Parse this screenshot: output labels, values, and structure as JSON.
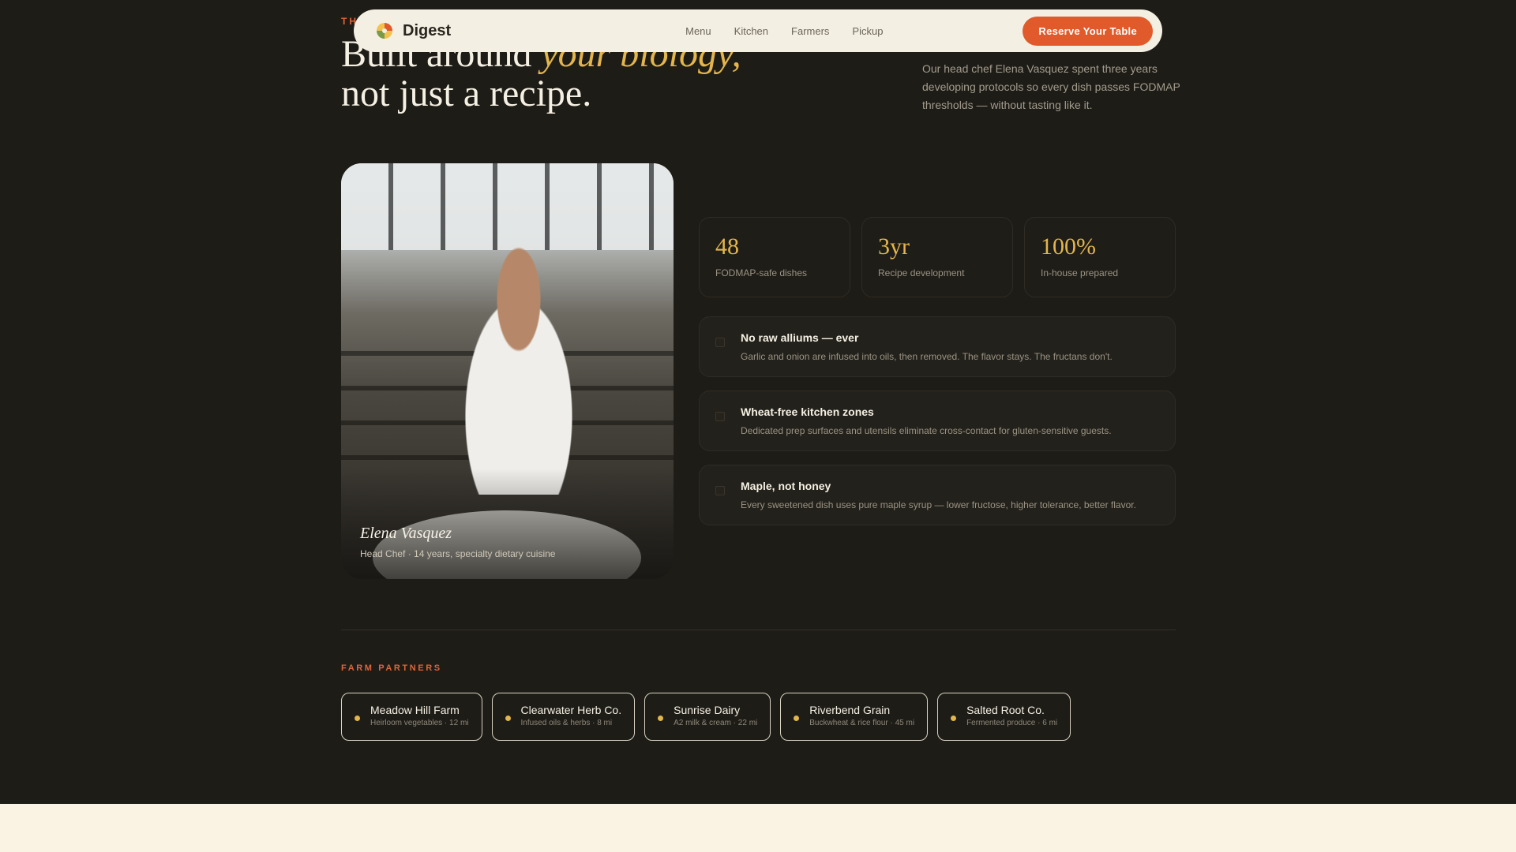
{
  "hero": {
    "eyebrow": "THE",
    "headline_part1": "Built around ",
    "headline_accent": "your biology,",
    "headline_part2": "not just a recipe.",
    "intro": "Our head chef Elena Vasquez spent three years developing protocols so every dish passes FODMAP thresholds — without tasting like it."
  },
  "navbar": {
    "brand": "Digest",
    "links": [
      "Menu",
      "Kitchen",
      "Farmers",
      "Pickup"
    ],
    "cta": "Reserve Your Table"
  },
  "chef": {
    "name": "Elena Vasquez",
    "role": "Head Chef · 14 years, specialty dietary cuisine"
  },
  "stats": [
    {
      "value": "48",
      "label": "FODMAP-safe dishes"
    },
    {
      "value": "3yr",
      "label": "Recipe development"
    },
    {
      "value": "100%",
      "label": "In-house prepared"
    }
  ],
  "features": [
    {
      "title": "No raw alliums — ever",
      "desc": "Garlic and onion are infused into oils, then removed. The flavor stays. The fructans don't."
    },
    {
      "title": "Wheat-free kitchen zones",
      "desc": "Dedicated prep surfaces and utensils eliminate cross-contact for gluten-sensitive guests."
    },
    {
      "title": "Maple, not honey",
      "desc": "Every sweetened dish uses pure maple syrup — lower fructose, higher tolerance, better flavor."
    }
  ],
  "farm_partners": {
    "label": "FARM PARTNERS",
    "farms": [
      {
        "name": "Meadow Hill Farm",
        "sub": "Heirloom vegetables · 12 mi"
      },
      {
        "name": "Clearwater Herb Co.",
        "sub": "Infused oils & herbs · 8 mi"
      },
      {
        "name": "Sunrise Dairy",
        "sub": "A2 milk & cream · 22 mi"
      },
      {
        "name": "Riverbend Grain",
        "sub": "Buckwheat & rice flour · 45 mi"
      },
      {
        "name": "Salted Root Co.",
        "sub": "Fermented produce · 6 mi"
      }
    ]
  },
  "colors": {
    "background": "#1e1c17",
    "accent_gold": "#e3b54c",
    "accent_orange": "#e05a2b",
    "nav_bg": "#f4efe3"
  }
}
